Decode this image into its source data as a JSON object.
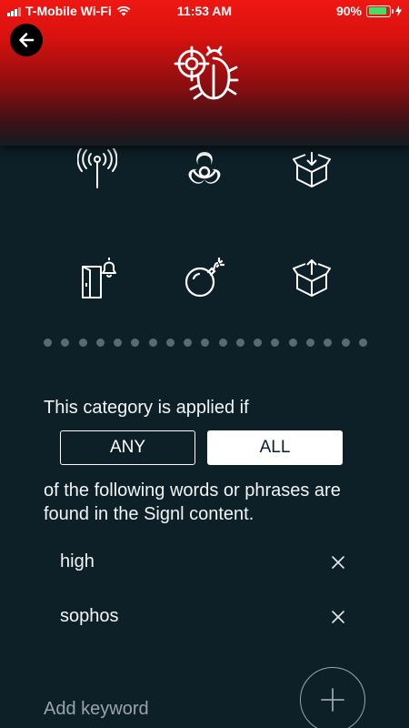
{
  "status_bar": {
    "carrier": "T-Mobile Wi-Fi",
    "time": "11:53 AM",
    "battery_percent": "90%",
    "battery_level": 0.9,
    "battery_color": "#4cd964"
  },
  "header": {
    "gradient_top": "#ef1712",
    "gradient_bottom": "#141c22",
    "logo_icon": "bug-crosshair-icon",
    "back_icon": "back-arrow-icon"
  },
  "category_icons": [
    "antenna-icon",
    "biohazard-icon",
    "box-download-icon",
    "door-bell-icon",
    "bomb-icon",
    "box-upload-icon"
  ],
  "pagination": {
    "dot_count": 19
  },
  "rule": {
    "intro": "This category is applied if",
    "options": [
      "ANY",
      "ALL"
    ],
    "selected": "ALL",
    "description_line1": "of the following words or phrases are",
    "description_line2": "found in the Signl content."
  },
  "keywords": [
    "high",
    "sophos"
  ],
  "add": {
    "label": "Add keyword",
    "icon": "plus-icon"
  }
}
